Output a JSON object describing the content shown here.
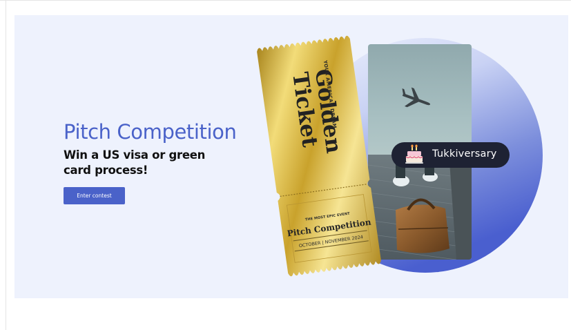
{
  "hero": {
    "headline": "Pitch Competition",
    "subheadline": "Win a US visa or green card process!",
    "cta_label": "Enter contest"
  },
  "ticket": {
    "title_line_1": "Golden",
    "title_line_2": "Ticket",
    "tagline": "YOUR AMERICAN DREAM",
    "event_kicker": "THE MOST EPIC EVENT",
    "event_title": "Pitch Competition",
    "event_dates": "OCTOBER | NOVEMBER 2024"
  },
  "badge": {
    "label": "Tukkiversary",
    "icon": "birthday-cake-icon"
  },
  "colors": {
    "accent": "#4a62c9",
    "hero_background": "#eef2fd",
    "badge_background": "#1e2233",
    "gold": "#d6b53a"
  }
}
